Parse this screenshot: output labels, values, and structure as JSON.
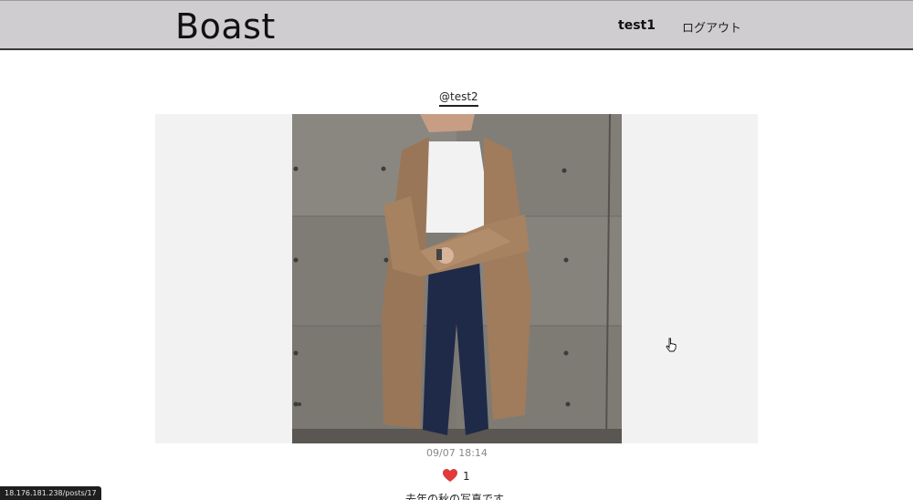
{
  "header": {
    "logo": "Boast",
    "user_name": "test1",
    "logout_label": "ログアウト"
  },
  "post": {
    "author": "@test2",
    "date": "09/07 18:14",
    "likes": "1",
    "caption": "去年の秋の写真です"
  },
  "status_bar": {
    "url": "18.176.181.238/posts/17"
  },
  "colors": {
    "header_bg": "#cfcdd0",
    "heart": "#e03a3a"
  },
  "icons": {
    "like": "heart-icon",
    "cursor": "hand-pointer-icon"
  }
}
